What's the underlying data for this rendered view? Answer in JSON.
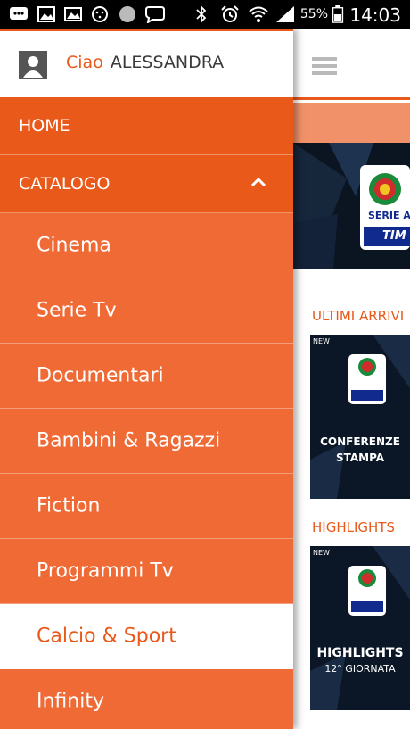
{
  "status_bar": {
    "battery_percent": "55%",
    "time": "14:03",
    "icons": [
      "chat-icon",
      "image-icon",
      "gallery-icon",
      "face-icon",
      "circle-icon",
      "speech-icon",
      "bluetooth-icon",
      "alarm-icon",
      "wifi-icon",
      "signal-icon",
      "battery-icon"
    ]
  },
  "drawer": {
    "greeting": "Ciao",
    "user_name": "ALESSANDRA",
    "menu": [
      {
        "label": "HOME",
        "level": "top"
      },
      {
        "label": "CATALOGO",
        "level": "top",
        "expanded": true
      },
      {
        "label": "Cinema",
        "level": "sub"
      },
      {
        "label": "Serie Tv",
        "level": "sub"
      },
      {
        "label": "Documentari",
        "level": "sub"
      },
      {
        "label": "Bambini & Ragazzi",
        "level": "sub"
      },
      {
        "label": "Fiction",
        "level": "sub"
      },
      {
        "label": "Programmi Tv",
        "level": "sub"
      },
      {
        "label": "Calcio & Sport",
        "level": "sub",
        "selected": true
      },
      {
        "label": "Infinity",
        "level": "sub"
      }
    ]
  },
  "content": {
    "sections": [
      {
        "title": "ULTIMI ARRIVI",
        "poster_badge": "NEW",
        "poster_line1": "CONFERENZE",
        "poster_line2": "STAMPA"
      },
      {
        "title": "HIGHLIGHTS",
        "poster_badge": "NEW",
        "poster_line1": "HIGHLIGHTS",
        "poster_line2": "12° GIORNATA"
      }
    ],
    "banner_logo_text": "SERIE A",
    "banner_sponsor": "TIM"
  },
  "colors": {
    "accent": "#e8591a",
    "menu_sub_bg": "#ef6a35",
    "selected_bg": "#ffffff"
  }
}
